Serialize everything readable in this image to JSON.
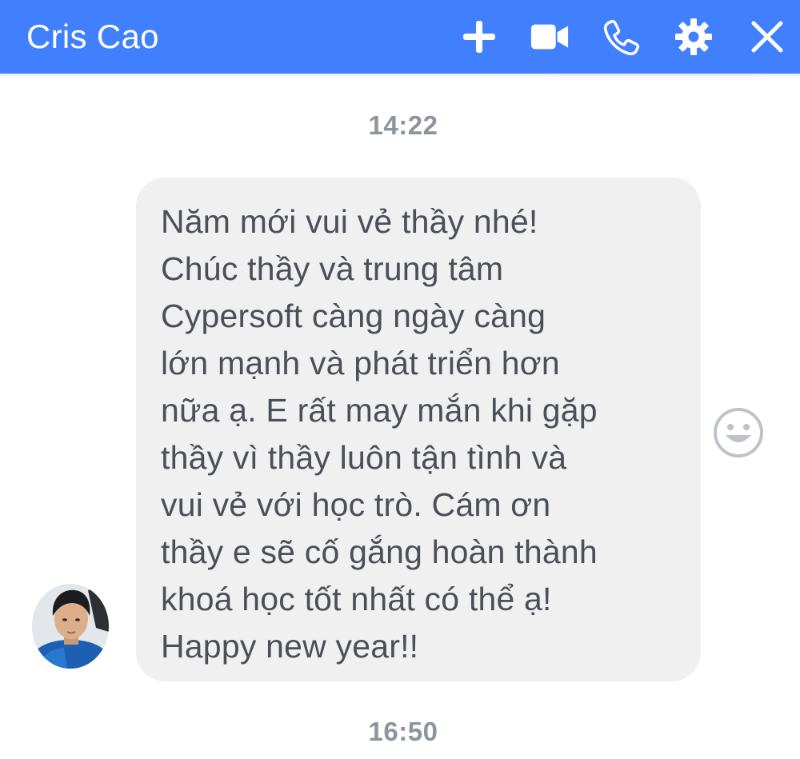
{
  "header": {
    "title": "Cris Cao",
    "accent_color": "#4080ff",
    "icons": [
      {
        "name": "plus-icon"
      },
      {
        "name": "video-call-icon"
      },
      {
        "name": "phone-icon"
      },
      {
        "name": "gear-icon"
      },
      {
        "name": "close-icon"
      }
    ]
  },
  "conversation": {
    "timestamps": [
      "14:22",
      "16:50"
    ],
    "message": {
      "text": "Năm mới vui vẻ thầy nhé!\nChúc thầy và trung tâm\nCypersoft càng ngày càng\nlớn mạnh và phát triển hơn\nnữa ạ. E rất may mắn khi gặp\nthầy vì thầy luôn tận tình và\nvui vẻ với học trò. Cám ơn\nthầy e sẽ cố gắng hoàn thành\nkhoá học tốt nhất có thể ạ!\nHappy new year!!",
      "bubble_color": "#f1f0f0",
      "reaction_icon": "smiley-face-icon"
    },
    "sender_avatar": "avatar-photo"
  }
}
